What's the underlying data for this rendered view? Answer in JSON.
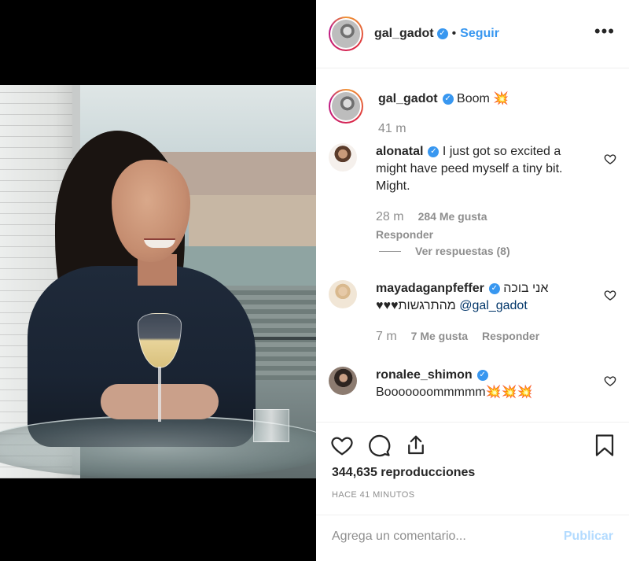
{
  "header": {
    "username": "gal_gadot",
    "separator": "•",
    "follow_label": "Seguir",
    "more_label": "•••"
  },
  "caption": {
    "username": "gal_gadot",
    "text": "Boom 💥",
    "time": "41 m"
  },
  "comments": [
    {
      "username": "alonatal",
      "text": "I just got so excited a might have peed myself a tiny bit. Might.",
      "time": "28 m",
      "likes": "284 Me gusta",
      "reply_label": "Responder",
      "view_replies": "Ver respuestas (8)"
    },
    {
      "username": "mayadaganpfeffer",
      "text_rtl": "אני בוכה מהתרגשות♥♥♥",
      "mention": "@gal_gadot",
      "time": "7 m",
      "likes": "7 Me gusta",
      "reply_label": "Responder"
    },
    {
      "username": "ronalee_shimon",
      "text": "Booooooommmmm💥💥💥"
    }
  ],
  "actions": {
    "views": "344,635 reproducciones",
    "time_ago": "HACE 41 MINUTOS"
  },
  "add_comment": {
    "placeholder": "Agrega un comentario...",
    "publish_label": "Publicar"
  },
  "colors": {
    "accent_blue": "#3897f0",
    "publish_disabled": "#b3dbff",
    "muted": "#8e8e8e"
  },
  "icons": [
    "heart-icon",
    "comment-icon",
    "share-icon",
    "bookmark-icon",
    "verified-badge-icon",
    "more-options-icon"
  ]
}
